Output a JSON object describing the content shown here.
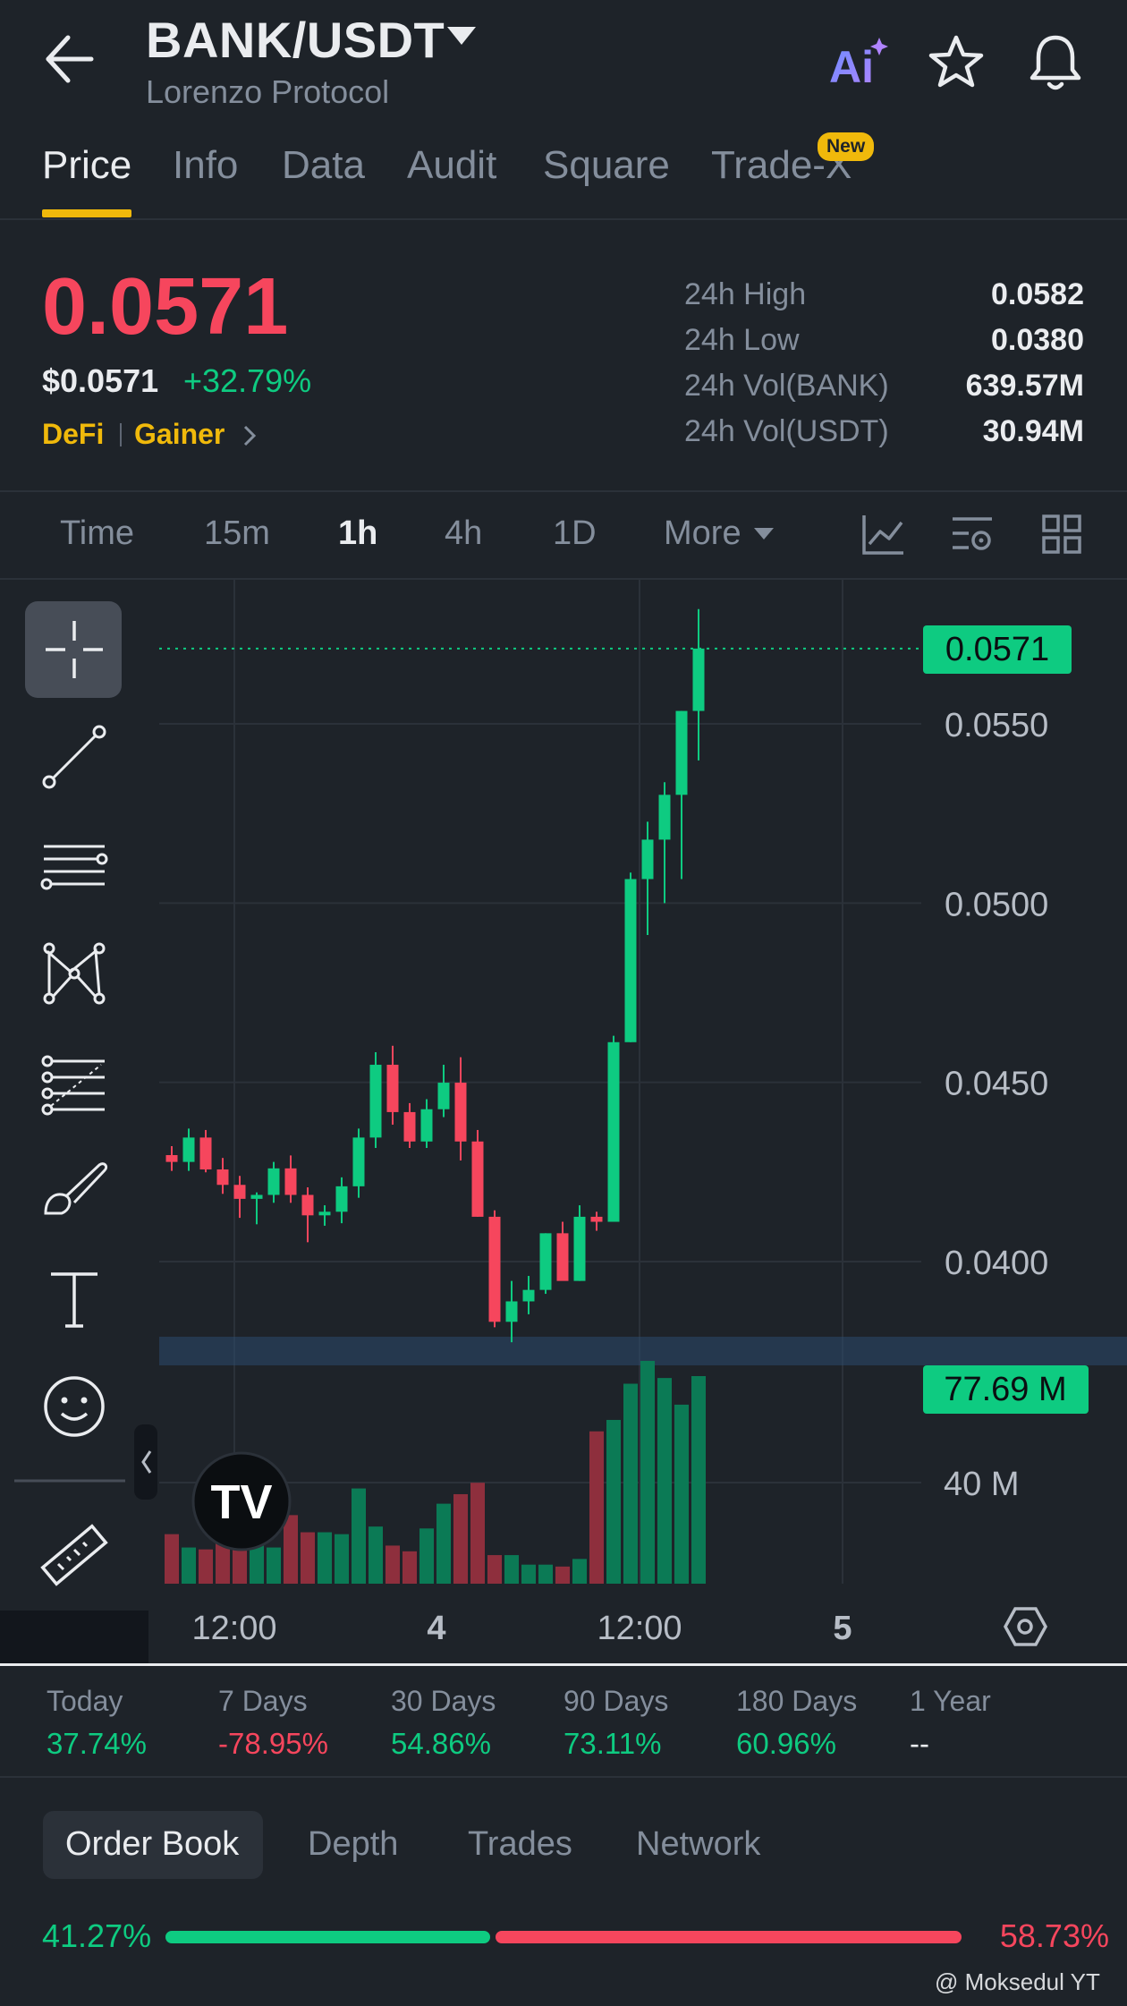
{
  "header": {
    "pair": "BANK/USDT",
    "project": "Lorenzo Protocol",
    "ai_label": "Ai",
    "icons": [
      "back-arrow-icon",
      "ai-icon",
      "star-icon",
      "bell-icon"
    ]
  },
  "tabs": [
    {
      "label": "Price",
      "active": true
    },
    {
      "label": "Info"
    },
    {
      "label": "Data"
    },
    {
      "label": "Audit"
    },
    {
      "label": "Square"
    },
    {
      "label": "Trade-X",
      "badge": "New"
    }
  ],
  "price": {
    "last": "0.0571",
    "usd": "$0.0571",
    "change": "+32.79%",
    "tags": [
      "DeFi",
      "Gainer"
    ]
  },
  "stats": [
    {
      "label": "24h High",
      "value": "0.0582"
    },
    {
      "label": "24h Low",
      "value": "0.0380"
    },
    {
      "label": "24h Vol(BANK)",
      "value": "639.57M"
    },
    {
      "label": "24h Vol(USDT)",
      "value": "30.94M"
    }
  ],
  "intervals": [
    {
      "label": "Time"
    },
    {
      "label": "15m"
    },
    {
      "label": "1h",
      "active": true
    },
    {
      "label": "4h"
    },
    {
      "label": "1D"
    },
    {
      "label": "More"
    }
  ],
  "colors": {
    "up": "#0ecb81",
    "down": "#f6465d",
    "accent": "#f0b90b",
    "bg": "#1e2329"
  },
  "chart_data": {
    "type": "candlestick",
    "interval": "1h",
    "price_ticks": [
      "0.0550",
      "0.0500",
      "0.0450",
      "0.0400"
    ],
    "price_range": [
      0.0368,
      0.059
    ],
    "last_price_label": "0.0571",
    "volume_label": "77.69 M",
    "volume_tick": "40 M",
    "x_labels": [
      "12:00",
      "4",
      "12:00",
      "5"
    ],
    "candles": [
      [
        0.04297,
        0.04322,
        0.04253,
        0.04278
      ],
      [
        0.04278,
        0.04371,
        0.04253,
        0.04346
      ],
      [
        0.04346,
        0.04367,
        0.04249,
        0.04257
      ],
      [
        0.04257,
        0.04289,
        0.04189,
        0.04214
      ],
      [
        0.04214,
        0.04239,
        0.04122,
        0.04175
      ],
      [
        0.04175,
        0.04193,
        0.04104,
        0.04186
      ],
      [
        0.04186,
        0.04278,
        0.04164,
        0.0426
      ],
      [
        0.0426,
        0.04296,
        0.04164,
        0.04186
      ],
      [
        0.04186,
        0.04207,
        0.04054,
        0.04129
      ],
      [
        0.04129,
        0.04157,
        0.041,
        0.04139
      ],
      [
        0.04139,
        0.04235,
        0.04107,
        0.0421
      ],
      [
        0.0421,
        0.04371,
        0.04178,
        0.04346
      ],
      [
        0.04346,
        0.04584,
        0.04317,
        0.04549
      ],
      [
        0.04549,
        0.04602,
        0.04382,
        0.04417
      ],
      [
        0.04417,
        0.04442,
        0.04317,
        0.04335
      ],
      [
        0.04335,
        0.04453,
        0.04317,
        0.04425
      ],
      [
        0.04425,
        0.04549,
        0.04403,
        0.04499
      ],
      [
        0.04499,
        0.0457,
        0.04282,
        0.04335
      ],
      [
        0.04335,
        0.04367,
        0.04125,
        0.04125
      ],
      [
        0.04125,
        0.04143,
        0.03817,
        0.03832
      ],
      [
        0.03832,
        0.03946,
        0.03775,
        0.03889
      ],
      [
        0.03889,
        0.0396,
        0.03853,
        0.03921
      ],
      [
        0.03921,
        0.04079,
        0.0391,
        0.04079
      ],
      [
        0.04079,
        0.04111,
        0.03971,
        0.03946
      ],
      [
        0.03946,
        0.04157,
        0.03946,
        0.04125
      ],
      [
        0.04125,
        0.04139,
        0.04086,
        0.04111
      ],
      [
        0.04111,
        0.0463,
        0.04111,
        0.04612
      ],
      [
        0.04612,
        0.05085,
        0.04612,
        0.05067
      ],
      [
        0.05067,
        0.05227,
        0.04911,
        0.05177
      ],
      [
        0.05177,
        0.05337,
        0.05,
        0.05302
      ],
      [
        0.05302,
        0.05536,
        0.05067,
        0.05536
      ],
      [
        0.05536,
        0.0582,
        0.05398,
        0.0571
      ]
    ],
    "volume": [
      0.26,
      0.19,
      0.18,
      0.24,
      0.31,
      0.25,
      0.19,
      0.36,
      0.27,
      0.27,
      0.26,
      0.5,
      0.3,
      0.2,
      0.17,
      0.29,
      0.42,
      0.47,
      0.53,
      0.15,
      0.15,
      0.1,
      0.1,
      0.09,
      0.13,
      0.8,
      0.86,
      1.05,
      1.17,
      1.08,
      0.94,
      1.09
    ],
    "volume_max": 1.09
  },
  "periods": [
    {
      "label": "Today",
      "value": "37.74%",
      "color": "#0ecb81"
    },
    {
      "label": "7 Days",
      "value": "-78.95%",
      "color": "#f6465d"
    },
    {
      "label": "30 Days",
      "value": "54.86%",
      "color": "#0ecb81"
    },
    {
      "label": "90 Days",
      "value": "73.11%",
      "color": "#0ecb81"
    },
    {
      "label": "180 Days",
      "value": "60.96%",
      "color": "#0ecb81"
    },
    {
      "label": "1 Year",
      "value": "--",
      "color": "#eaecef"
    }
  ],
  "orderbook": {
    "tabs": [
      "Order Book",
      "Depth",
      "Trades",
      "Network"
    ],
    "bid_ratio": "41.27%",
    "ask_ratio": "58.73%",
    "bid_fraction": 0.4127
  },
  "watermark": "@ Moksedul YT"
}
